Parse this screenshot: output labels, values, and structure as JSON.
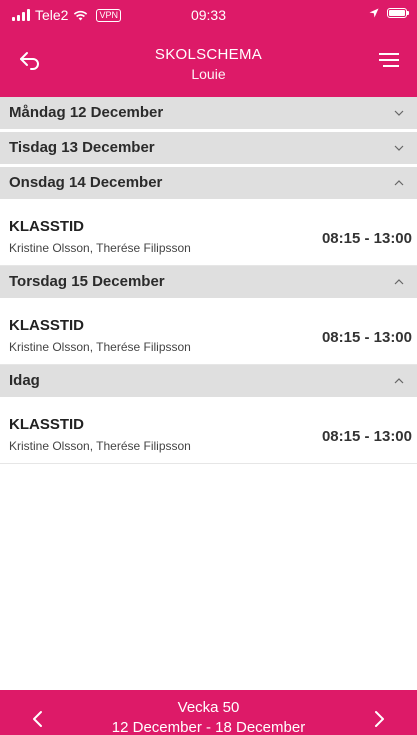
{
  "status_bar": {
    "carrier": "Tele2",
    "vpn_label": "VPN",
    "time": "09:33"
  },
  "nav": {
    "title": "SKOLSCHEMA",
    "subtitle": "Louie",
    "back_icon": "back-arrow-icon",
    "menu_icon": "hamburger-menu-icon"
  },
  "days": [
    {
      "label": "Måndag 12 December",
      "expanded": false,
      "lessons": []
    },
    {
      "label": "Tisdag 13 December",
      "expanded": false,
      "lessons": []
    },
    {
      "label": "Onsdag 14 December",
      "expanded": true,
      "lessons": [
        {
          "title": "KLASSTID",
          "teachers": "Kristine Olsson, Therése Filipsson",
          "time": "08:15 - 13:00"
        }
      ]
    },
    {
      "label": "Torsdag 15 December",
      "expanded": true,
      "lessons": [
        {
          "title": "KLASSTID",
          "teachers": "Kristine Olsson, Therése Filipsson",
          "time": "08:15 - 13:00"
        }
      ]
    },
    {
      "label": "Idag",
      "expanded": true,
      "lessons": [
        {
          "title": "KLASSTID",
          "teachers": "Kristine Olsson, Therése Filipsson",
          "time": "08:15 - 13:00"
        }
      ]
    }
  ],
  "footer": {
    "week": "Vecka 50",
    "range": "12 December - 18 December"
  },
  "colors": {
    "brand": "#dd1a68",
    "day_header_bg": "#dfdfdf"
  }
}
